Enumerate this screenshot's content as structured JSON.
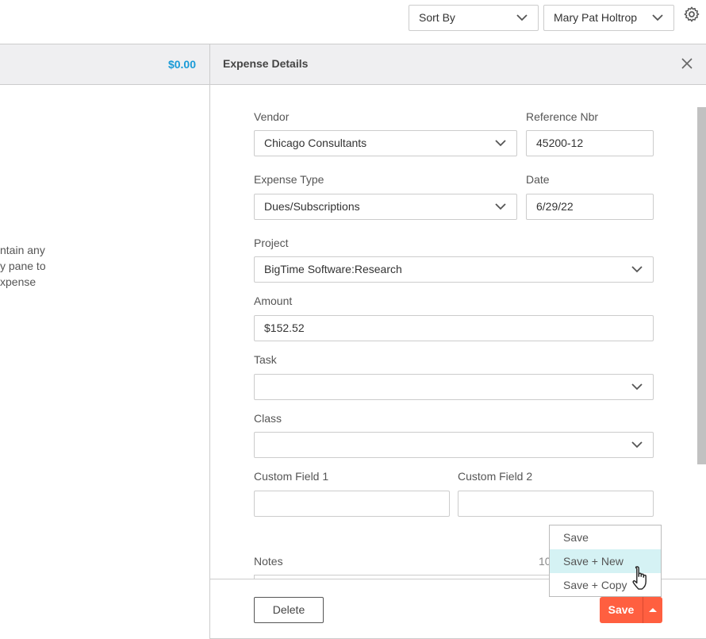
{
  "toolbar": {
    "sort_by": "Sort By",
    "user": "Mary Pat Holtrop",
    "settings_icon": "gear-icon"
  },
  "left_pane": {
    "total": "$0.00",
    "message_lines": [
      "ntain any",
      "y pane to",
      "xpense"
    ],
    "total_color": "#1a9bd7"
  },
  "panel": {
    "title": "Expense Details",
    "close_icon": "close-icon",
    "fields": {
      "vendor": {
        "label": "Vendor",
        "value": "Chicago Consultants"
      },
      "reference": {
        "label": "Reference Nbr",
        "value": "45200-12"
      },
      "expense_type": {
        "label": "Expense Type",
        "value": "Dues/Subscriptions"
      },
      "date": {
        "label": "Date",
        "value": "6/29/22"
      },
      "project": {
        "label": "Project",
        "value": "BigTime Software:Research"
      },
      "amount": {
        "label": "Amount",
        "value": "$152.52"
      },
      "task": {
        "label": "Task",
        "value": ""
      },
      "class": {
        "label": "Class",
        "value": ""
      },
      "custom1": {
        "label": "Custom Field 1",
        "value": ""
      },
      "custom2": {
        "label": "Custom Field 2",
        "value": ""
      },
      "notes": {
        "label": "Notes",
        "counter": "10"
      }
    },
    "footer": {
      "delete": "Delete",
      "save": "Save",
      "save_color": "#ff5f40"
    },
    "save_menu": {
      "items": [
        "Save",
        "Save + New",
        "Save + Copy"
      ],
      "highlighted": "Save + New"
    }
  }
}
